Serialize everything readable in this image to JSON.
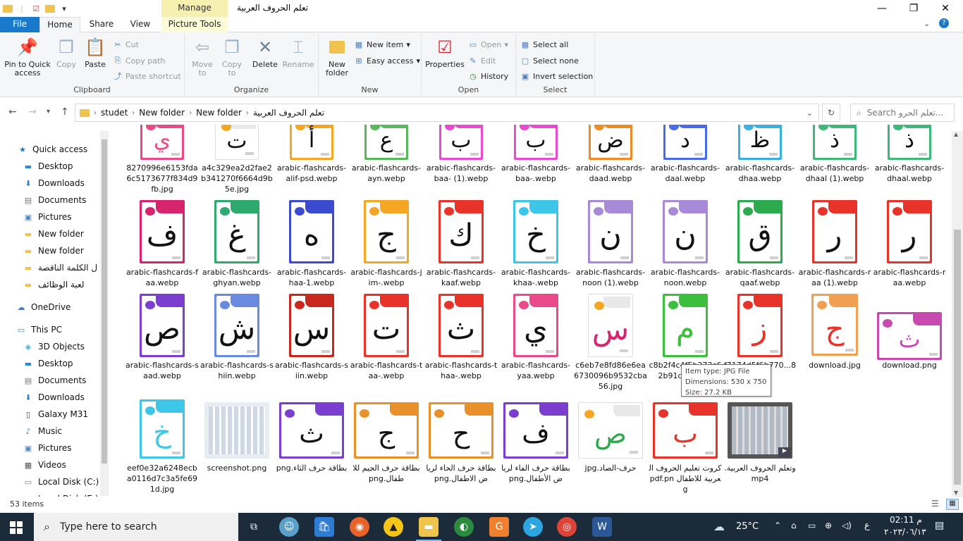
{
  "window": {
    "title": "تعلم الحروف العربية",
    "contextual_tab_group": "Manage",
    "controls": [
      "—",
      "❐",
      "✕"
    ]
  },
  "tabs": [
    "File",
    "Home",
    "Share",
    "View",
    "Picture Tools"
  ],
  "ribbon": {
    "clipboard": {
      "label": "Clipboard",
      "pin": "Pin to Quick access",
      "copy": "Copy",
      "paste": "Paste",
      "cut": "Cut",
      "copy_path": "Copy path",
      "paste_shortcut": "Paste shortcut"
    },
    "organize": {
      "label": "Organize",
      "move_to": "Move to",
      "copy_to": "Copy to",
      "delete": "Delete",
      "rename": "Rename"
    },
    "new": {
      "label": "New",
      "new_folder": "New folder",
      "new_item": "New item",
      "easy_access": "Easy access"
    },
    "open": {
      "label": "Open",
      "properties": "Properties",
      "open": "Open",
      "edit": "Edit",
      "history": "History"
    },
    "select": {
      "label": "Select",
      "select_all": "Select all",
      "select_none": "Select none",
      "invert": "Invert selection"
    }
  },
  "address": {
    "crumbs": [
      "studet",
      "New folder",
      "New folder",
      "تعلم الحروف العربية"
    ],
    "search_placeholder": "Search تعلم الحرو..."
  },
  "nav": {
    "items": [
      {
        "label": "Quick access",
        "icon": "star-icon"
      },
      {
        "label": "Desktop",
        "icon": "desktop-icon",
        "pinned": true
      },
      {
        "label": "Downloads",
        "icon": "download-icon",
        "pinned": true
      },
      {
        "label": "Documents",
        "icon": "documents-icon",
        "pinned": true
      },
      {
        "label": "Pictures",
        "icon": "pictures-icon",
        "pinned": true
      },
      {
        "label": "New folder",
        "icon": "folder-icon"
      },
      {
        "label": "New folder",
        "icon": "folder-icon"
      },
      {
        "label": "ل الكلمة الناقصة",
        "icon": "folder-icon"
      },
      {
        "label": "لعبة الوظائف",
        "icon": "folder-icon"
      },
      {
        "label": "OneDrive",
        "icon": "cloud-icon"
      },
      {
        "label": "This PC",
        "icon": "pc-icon"
      },
      {
        "label": "3D Objects",
        "icon": "cube-icon"
      },
      {
        "label": "Desktop",
        "icon": "desktop-icon"
      },
      {
        "label": "Documents",
        "icon": "documents-icon"
      },
      {
        "label": "Downloads",
        "icon": "download-icon"
      },
      {
        "label": "Galaxy M31",
        "icon": "phone-icon"
      },
      {
        "label": "Music",
        "icon": "music-icon"
      },
      {
        "label": "Pictures",
        "icon": "pictures-icon"
      },
      {
        "label": "Videos",
        "icon": "video-icon"
      },
      {
        "label": "Local Disk (C:)",
        "icon": "disk-icon"
      },
      {
        "label": "Local Disk (E:)",
        "icon": "disk-icon"
      }
    ]
  },
  "files": {
    "row1": [
      {
        "name": "8270996e6153fda6c5173677f834d9fb.jpg",
        "glyph": "ي",
        "color": "#e84a8a",
        "gcolor": "#e84a8a"
      },
      {
        "name": "a4c329ea2d2fae2b341270f6664d9b5e.jpg",
        "glyph": "ت",
        "color": "#ffffff",
        "gcolor": "#111"
      },
      {
        "name": "arabic-flashcards-alif-psd.webp",
        "glyph": "أ",
        "color": "#f5a623",
        "gcolor": "#111"
      },
      {
        "name": "arabic-flashcards-ayn.webp",
        "glyph": "ع",
        "color": "#5cb85c",
        "gcolor": "#111"
      },
      {
        "name": "arabic-flashcards-baa- (1).webp",
        "glyph": "ب",
        "color": "#e84ad0",
        "gcolor": "#111"
      },
      {
        "name": "arabic-flashcards-baa-.webp",
        "glyph": "ب",
        "color": "#e84ad0",
        "gcolor": "#111"
      },
      {
        "name": "arabic-flashcards-daad.webp",
        "glyph": "ض",
        "color": "#f08a24",
        "gcolor": "#111"
      },
      {
        "name": "arabic-flashcards-daal.webp",
        "glyph": "د",
        "color": "#4a6be8",
        "gcolor": "#111"
      },
      {
        "name": "arabic-flashcards-dhaa.webp",
        "glyph": "ظ",
        "color": "#3bb0e0",
        "gcolor": "#111"
      },
      {
        "name": "arabic-flashcards-dhaal (1).webp",
        "glyph": "ذ",
        "color": "#3cb878",
        "gcolor": "#111"
      },
      {
        "name": "arabic-flashcards-dhaal.webp",
        "glyph": "ذ",
        "color": "#3cb878",
        "gcolor": "#111"
      }
    ],
    "row2": [
      {
        "name": "arabic-flashcards-faa.webp",
        "glyph": "ف",
        "color": "#d6246e",
        "gcolor": "#111"
      },
      {
        "name": "arabic-flashcards-ghyan.webp",
        "glyph": "غ",
        "color": "#2eaa6e",
        "gcolor": "#111"
      },
      {
        "name": "arabic-flashcards-haa-1.webp",
        "glyph": "ه",
        "color": "#3a4bd0",
        "gcolor": "#111"
      },
      {
        "name": "arabic-flashcards-jim-.webp",
        "glyph": "ج",
        "color": "#f5a623",
        "gcolor": "#111"
      },
      {
        "name": "arabic-flashcards-kaaf.webp",
        "glyph": "ك",
        "color": "#e8332a",
        "gcolor": "#111"
      },
      {
        "name": "arabic-flashcards-khaa-.webp",
        "glyph": "خ",
        "color": "#3ec6e8",
        "gcolor": "#111"
      },
      {
        "name": "arabic-flashcards-noon (1).webp",
        "glyph": "ن",
        "color": "#a98ad8",
        "gcolor": "#111"
      },
      {
        "name": "arabic-flashcards-noon.webp",
        "glyph": "ن",
        "color": "#a98ad8",
        "gcolor": "#111"
      },
      {
        "name": "arabic-flashcards-qaaf.webp",
        "glyph": "ق",
        "color": "#2eaa4e",
        "gcolor": "#111"
      },
      {
        "name": "arabic-flashcards-raa (1).webp",
        "glyph": "ر",
        "color": "#e8332a",
        "gcolor": "#111"
      },
      {
        "name": "arabic-flashcards-raa.webp",
        "glyph": "ر",
        "color": "#e8332a",
        "gcolor": "#111"
      }
    ],
    "row3": [
      {
        "name": "arabic-flashcards-saad.webp",
        "glyph": "ص",
        "color": "#7b3fd0",
        "gcolor": "#111"
      },
      {
        "name": "arabic-flashcards-shiin.webp",
        "glyph": "ش",
        "color": "#6a8ae0",
        "gcolor": "#111"
      },
      {
        "name": "arabic-flashcards-siin.webp",
        "glyph": "س",
        "color": "#c8281e",
        "gcolor": "#111"
      },
      {
        "name": "arabic-flashcards-taa-.webp",
        "glyph": "ت",
        "color": "#e8332a",
        "gcolor": "#111"
      },
      {
        "name": "arabic-flashcards-thaa-.webp",
        "glyph": "ث",
        "color": "#e8332a",
        "gcolor": "#111"
      },
      {
        "name": "arabic-flashcards-yaa.webp",
        "glyph": "ي",
        "color": "#e84a8a",
        "gcolor": "#111"
      },
      {
        "name": "c6eb7e8fd86e6ea6730096b9532cba56.jpg",
        "glyph": "س",
        "color": "#ffffff",
        "gcolor": "#d6246e"
      },
      {
        "name": "c8b2f4c4f5b373c62b91dd...85...",
        "glyph": "م",
        "color": "#3cbf3c",
        "gcolor": "#3cbf3c"
      },
      {
        "name": "f7174d5f6b770...852b",
        "glyph": "ز",
        "color": "#e8332a",
        "gcolor": "#e8332a"
      },
      {
        "name": "download.jpg",
        "glyph": "ج",
        "color": "#f0a050",
        "gcolor": "#e8332a"
      },
      {
        "name": "download.png",
        "glyph": "ث",
        "color": "#c84ab0",
        "gcolor": "#c84ab0"
      }
    ],
    "row4": [
      {
        "name": "eef0e32a6248ecba0116d7c3a5fe691d.jpg",
        "glyph": "خ",
        "color": "#3ec6e8",
        "gcolor": "#3ec6e8"
      },
      {
        "name": "screenshot.png",
        "glyph": "",
        "color": "#e9edf2",
        "gcolor": "#111"
      },
      {
        "name": "بطاقة حرف الثاء.png",
        "glyph": "ث",
        "color": "#7b3fd0",
        "gcolor": "#111"
      },
      {
        "name": "بطاقة حرف الجيم للاطفال.png",
        "glyph": "ج",
        "color": "#e8902a",
        "gcolor": "#111"
      },
      {
        "name": "بطاقة حرف الحاء لرياض الاطفال.png",
        "glyph": "ح",
        "color": "#e8902a",
        "gcolor": "#111"
      },
      {
        "name": "بطاقة حرف الفاء لرياض الأطفال.png",
        "glyph": "ف",
        "color": "#7b3fd0",
        "gcolor": "#111"
      },
      {
        "name": "حرف-الصاد.jpg",
        "glyph": "ص",
        "color": "#ffffff",
        "gcolor": "#2eaa4e"
      },
      {
        "name": "كروت تعليم الحروف العربية للاطفال pdf.png",
        "glyph": "ب",
        "color": "#e8332a",
        "gcolor": "#e8332a"
      },
      {
        "name": "وتعلم الحروف العربية.mp4",
        "glyph": "",
        "color": "#555555",
        "gcolor": "#111"
      }
    ]
  },
  "tooltip": {
    "type": "Item type: JPG File",
    "dims": "Dimensions: 530 x 750",
    "size": "Size: 27.2 KB"
  },
  "status": {
    "count": "53 items"
  },
  "taskbar": {
    "search_placeholder": "Type here to search",
    "weather": "25°C",
    "time": "02:11 م",
    "date": "٢٠٢٣/٠٦/١٣",
    "lang": "ع"
  }
}
